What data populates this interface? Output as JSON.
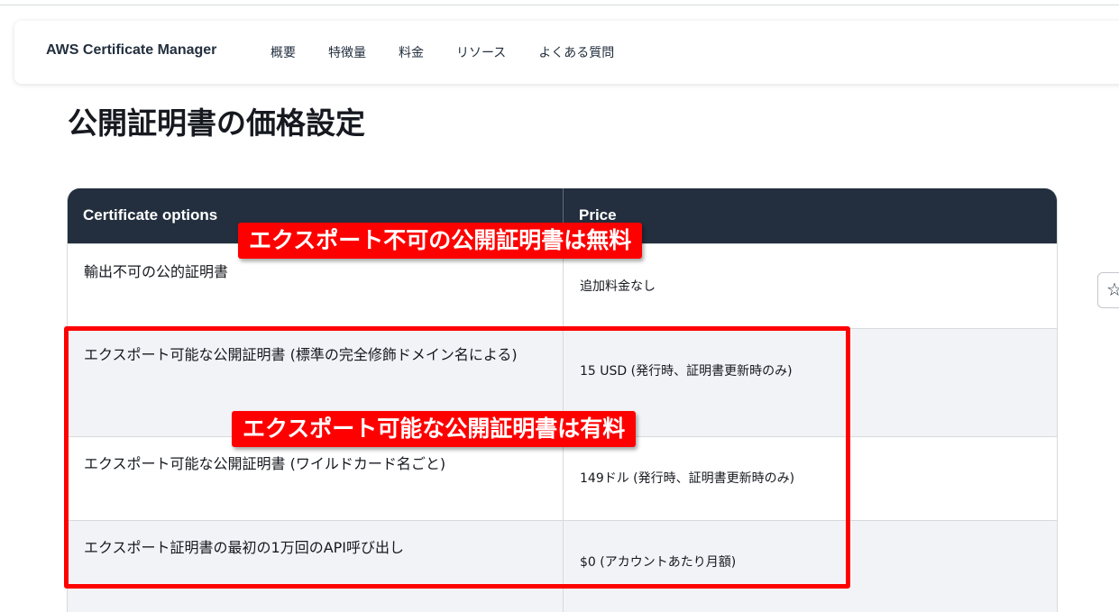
{
  "navbar": {
    "brand": "AWS Certificate Manager",
    "links": [
      "概要",
      "特徴量",
      "料金",
      "リソース",
      "よくある質問"
    ]
  },
  "page": {
    "title": "公開証明書の価格設定"
  },
  "table": {
    "headers": [
      "Certificate options",
      "Price"
    ],
    "rows": [
      {
        "option": "輸出不可の公的証明書",
        "price": "追加料金なし"
      },
      {
        "option": "エクスポート可能な公開証明書 (標準の完全修飾ドメイン名による)",
        "price": "15 USD (発行時、証明書更新時のみ)"
      },
      {
        "option": "エクスポート可能な公開証明書 (ワイルドカード名ごと)",
        "price": "149ドル (発行時、証明書更新時のみ)"
      },
      {
        "option": "エクスポート証明書の最初の1万回のAPI呼び出し",
        "price": "$0 (アカウントあたり月額)"
      }
    ]
  },
  "annotations": {
    "callout_free": "エクスポート不可の公開証明書は無料",
    "callout_paid": "エクスポート可能な公開証明書は有料",
    "color": "#ff0000"
  },
  "side_button": {
    "icon": "star-icon",
    "glyph": "☆"
  },
  "colors": {
    "header_bg": "#232f3e",
    "alt_row_bg": "#f2f3f7",
    "annotation_red": "#ff0000"
  }
}
